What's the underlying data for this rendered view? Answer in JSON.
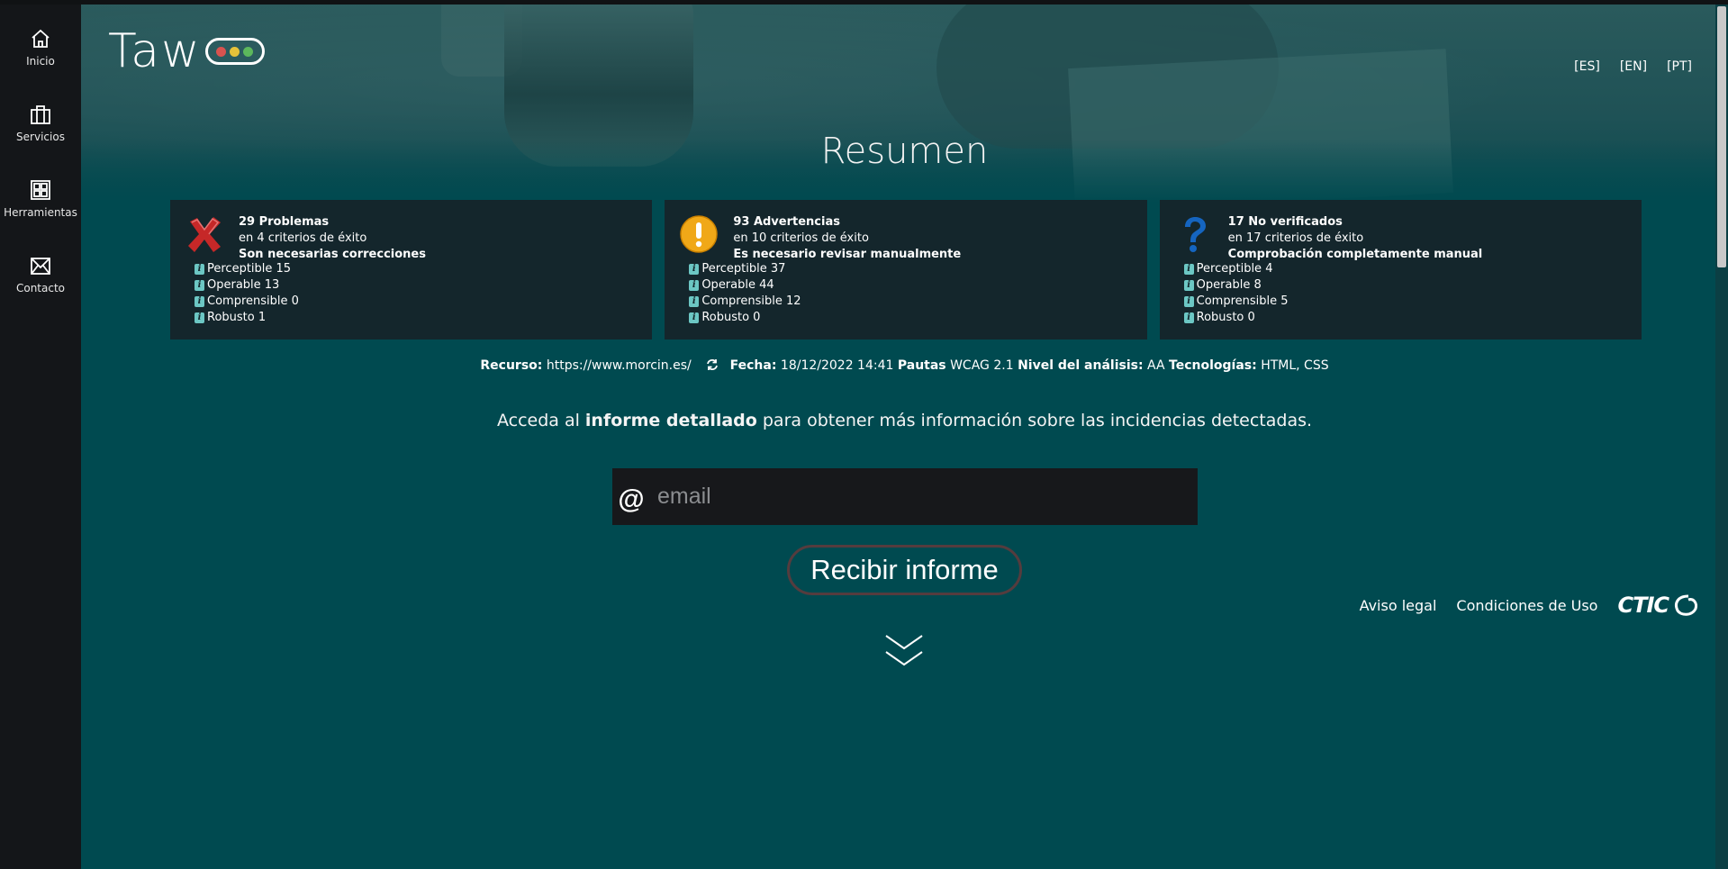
{
  "sidebar": {
    "items": [
      {
        "label": "Inicio",
        "icon": "home-icon"
      },
      {
        "label": "Servicios",
        "icon": "briefcase-icon"
      },
      {
        "label": "Herramientas",
        "icon": "tools-grid-icon"
      },
      {
        "label": "Contacto",
        "icon": "envelope-icon"
      }
    ]
  },
  "logo": {
    "text": "Taw",
    "lights": [
      "#d9534f",
      "#e5c23a",
      "#5cb85c"
    ]
  },
  "languages": [
    "[ES]",
    "[EN]",
    "[PT]"
  ],
  "title": "Resumen",
  "cards": [
    {
      "icon": "error-x-icon",
      "count_label": "29 Problemas",
      "criteria": "en 4 criterios de éxito",
      "note": "Son necesarias correcciones",
      "rows": [
        "Perceptible 15",
        "Operable 13",
        "Comprensible 0",
        "Robusto 1"
      ]
    },
    {
      "icon": "warning-exclamation-icon",
      "count_label": "93 Advertencias",
      "criteria": "en 10 criterios de éxito",
      "note": "Es necesario revisar manualmente",
      "rows": [
        "Perceptible 37",
        "Operable 44",
        "Comprensible 12",
        "Robusto 0"
      ]
    },
    {
      "icon": "question-mark-icon",
      "count_label": "17 No verificados",
      "criteria": "en 17 criterios de éxito",
      "note": "Comprobación completamente manual",
      "rows": [
        "Perceptible 4",
        "Operable 8",
        "Comprensible 5",
        "Robusto 0"
      ]
    }
  ],
  "meta": {
    "resource_label": "Recurso:",
    "resource_value": "https://www.morcin.es/",
    "date_label": "Fecha:",
    "date_value": "18/12/2022 14:41",
    "guidelines_label": "Pautas",
    "guidelines_value": "WCAG 2.1",
    "level_label": "Nivel del análisis:",
    "level_value": "AA",
    "tech_label": "Tecnologías:",
    "tech_value": "HTML, CSS"
  },
  "access": {
    "before": "Acceda al ",
    "bold": "informe detallado",
    "after": " para obtener más información sobre las incidencias detectadas."
  },
  "email": {
    "at": "@",
    "placeholder": "email",
    "value": ""
  },
  "button": {
    "label": "Recibir informe"
  },
  "footer": {
    "legal": "Aviso legal",
    "terms": "Condiciones de Uso",
    "brand": "CTIC"
  },
  "colors": {
    "background": "#004a50",
    "sidebar": "#141619",
    "card": "#14262c",
    "info_icon": "#6cc7c4"
  }
}
